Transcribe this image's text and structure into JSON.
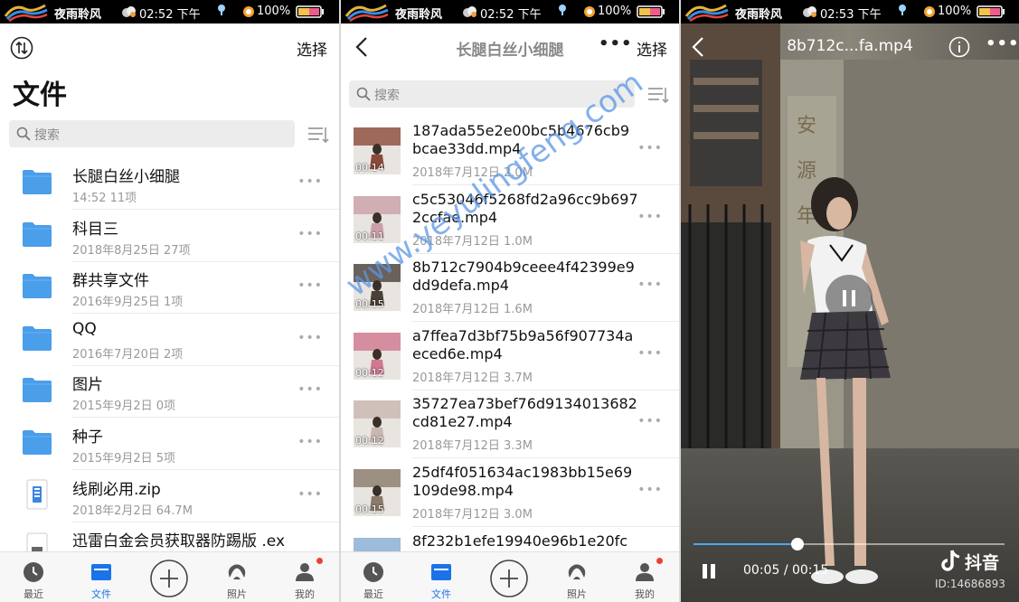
{
  "status_bars": [
    {
      "name": "夜雨聆风",
      "time": "02:52 下午",
      "battery": "100%"
    },
    {
      "name": "夜雨聆风",
      "time": "02:52 下午",
      "battery": "100%"
    },
    {
      "name": "夜雨聆风",
      "time": "02:53 下午",
      "battery": "100%"
    }
  ],
  "files_page": {
    "title": "文件",
    "select_label": "选择",
    "search_placeholder": "搜索",
    "items": [
      {
        "name": "长腿白丝小细腿",
        "meta": "14:52  11项",
        "kind": "folder"
      },
      {
        "name": "科目三",
        "meta": "2018年8月25日  27项",
        "kind": "folder"
      },
      {
        "name": "群共享文件",
        "meta": "2016年9月25日  1项",
        "kind": "folder"
      },
      {
        "name": "QQ",
        "meta": "2016年7月20日  2项",
        "kind": "folder"
      },
      {
        "name": "图片",
        "meta": "2015年9月2日  0项",
        "kind": "folder"
      },
      {
        "name": "种子",
        "meta": "2015年9月2日  5项",
        "kind": "folder"
      },
      {
        "name": "线刷必用.zip",
        "meta": "2018年2月2日  64.7M",
        "kind": "zip"
      },
      {
        "name": "迅雷白金会员获取器防踢版 .ex",
        "meta": "",
        "kind": "file"
      }
    ]
  },
  "folder_page": {
    "title": "长腿白丝小细腿",
    "select_label": "选择",
    "search_placeholder": "搜索",
    "watermark": "www.yeyulingfeng.com",
    "items": [
      {
        "name": "187ada55e2e00bc5b4676cb9bcae33dd.mp4",
        "meta": "2018年7月12日  2.0M",
        "duration": "00:14",
        "thumb_color": "#8a4a3a"
      },
      {
        "name": "c5c53046f5268fd2a96cc9b6972ccfae.mp4",
        "meta": "2018年7月12日  1.0M",
        "duration": "00:11",
        "thumb_color": "#c9a0a8"
      },
      {
        "name": "8b712c7904b9ceee4f42399e9dd9defa.mp4",
        "meta": "2018年7月12日  1.6M",
        "duration": "00:15",
        "thumb_color": "#4a4038"
      },
      {
        "name": "a7ffea7d3bf75b9a56f907734aeced6e.mp4",
        "meta": "2018年7月12日  3.7M",
        "duration": "00:12",
        "thumb_color": "#d07890"
      },
      {
        "name": "35727ea73bef76d9134013682cd81e27.mp4",
        "meta": "2018年7月12日  3.3M",
        "duration": "00:12",
        "thumb_color": "#c8b8b0"
      },
      {
        "name": "25df4f051634ac1983bb15e69109de98.mp4",
        "meta": "2018年7月12日  3.0M",
        "duration": "00:15",
        "thumb_color": "#8a7a6a"
      },
      {
        "name": "8f232b1efe19940e96b1e20fc",
        "meta": "",
        "duration": "",
        "thumb_color": "#8ab0d8"
      }
    ]
  },
  "player_page": {
    "title": "8b712c...fa.mp4",
    "current_time": "00:05",
    "total_time": "00:15",
    "progress": 0.333,
    "platform_label": "抖音",
    "platform_id": "ID:14686893"
  },
  "tabs": [
    {
      "label": "最近",
      "icon": "clock-icon"
    },
    {
      "label": "文件",
      "icon": "folder-icon"
    },
    {
      "label": "",
      "icon": "plus-icon"
    },
    {
      "label": "照片",
      "icon": "photos-icon"
    },
    {
      "label": "我的",
      "icon": "profile-icon"
    }
  ],
  "colors": {
    "accent": "#1a73e8",
    "folder": "#4a9eea",
    "badge": "#e94235",
    "seek": "#4da6ff"
  }
}
